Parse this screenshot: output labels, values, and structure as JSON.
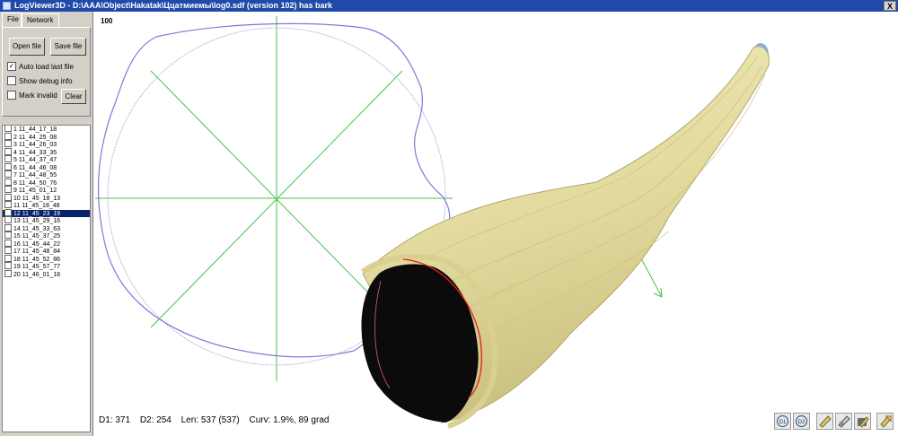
{
  "window": {
    "title": "LogViewer3D - D:\\AAA\\Object\\Hakatak\\Ццатмиемы\\log0.sdf (version 102) has bark",
    "close_label": "X"
  },
  "sidebar": {
    "tabs": [
      {
        "label": "File"
      },
      {
        "label": "Network"
      }
    ],
    "open_label": "Open file",
    "save_label": "Save file",
    "auto_load_label": "Auto load last file",
    "show_debug_label": "Show debug info",
    "mark_invalid_label": "Mark invalid",
    "clear_label": "Clear",
    "auto_load_checked": "✓"
  },
  "list": {
    "items": [
      "1 11_44_17_18",
      "2 11_44_25_08",
      "3 11_44_26_03",
      "4 11_44_33_35",
      "5 11_44_37_47",
      "6 11_44_46_08",
      "7 11_44_48_55",
      "8 11_44_50_76",
      "9 11_45_01_12",
      "10 11_45_18_13",
      "11 11_45_18_48",
      "12 11_45_23_19",
      "13 11_45_29_16",
      "14 11_45_33_63",
      "15 11_45_37_25",
      "16 11_45_44_22",
      "17 11_45_48_84",
      "18 11_45_52_86",
      "19 11_45_57_77",
      "20 11_46_01_18"
    ],
    "selected_index": 11
  },
  "viewport": {
    "scale_label": "100",
    "d1": "D1: 371",
    "d2": "D2: 254",
    "len": "Len: 537 (537)",
    "curv": "Curv: 1.9%, 89 grad"
  },
  "toolbar": {
    "icons": [
      "d1-view-icon",
      "d2-view-icon",
      "log-yellow-icon",
      "log-gear-icon",
      "log-box-icon",
      "rotate-arrow-icon"
    ]
  },
  "colors": {
    "titlebar": "#1f4aa8",
    "log": "#e8e0a6",
    "outline": "#7a7ad8",
    "axes": "#48c248",
    "cut": "#e02020"
  }
}
